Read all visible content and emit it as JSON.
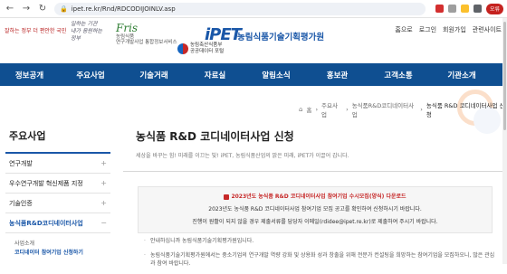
{
  "browser": {
    "url": "ipet.re.kr/Rnd/RDCODIJOINLV.asp",
    "profile_label": "오류",
    "extension_colors": [
      "#d32f2f",
      "#9e9e9e",
      "#fbc02d",
      "#5f6368"
    ]
  },
  "util_links": [
    "홈으로",
    "로그인",
    "회원가입",
    "관련사이트"
  ],
  "header": {
    "banner_left": "잘하는 정부 더 편안한 국민",
    "banner_right_lines": [
      "일하는 기관",
      "내가 응원하는",
      "정부"
    ],
    "fris_logo": "Fris",
    "fris_sub_lines": [
      "농림식품",
      "연구개발사업 통합정보서비스"
    ],
    "public_data_lines": [
      "농림축산식품부",
      "공공데이터 포털"
    ],
    "logo_text": "iPET",
    "org_name": "농림식품기술기획평가원",
    "accent_color": "#1a57a8"
  },
  "gnb": {
    "background": "#0f4f91",
    "items": [
      "정보공개",
      "주요사업",
      "기술거래",
      "자료실",
      "알림소식",
      "홍보관",
      "고객소통",
      "기관소개"
    ]
  },
  "breadcrumb": {
    "home_icon": "home-icon",
    "items": [
      "홈",
      "주요사업",
      "농식품R&D코디네이터사업",
      "농식품 R&D 코디네이터사업 신청"
    ]
  },
  "sidebar": {
    "title": "주요사업",
    "items": [
      {
        "label": "연구개발",
        "expand": "+"
      },
      {
        "label": "우수연구개발 혁신제품 지정",
        "expand": "+"
      },
      {
        "label": "기술인증",
        "expand": "+"
      },
      {
        "label": "농식품R&D코디네이터사업",
        "expand": "−"
      }
    ],
    "sub_items": [
      "사업소개",
      "코디네이터 참여기업 신청하기"
    ]
  },
  "content": {
    "title": "농식품 R&D 코디네이터사업 신청",
    "subtitle": "세상을 바꾸는 힘! 미래를 이끄는 빛! iPET, 농림식품산업의 밝은 미래, iPET가 이끌어 갑니다.",
    "notice": {
      "headline": "2023년도 농식품 R&D 코디네이터사업 참여기업 수시모집(양식) 다운로드",
      "line2": "2023년도 농식품 R&D 코디네이터사업 참여기업 모집 공고를 확인하여 신청하시기 바랍니다.",
      "line3": "진행이 원활이 되지 않을 경우 제출서류를 담당자 이메일(rdidee@ipet.re.kr)로 제출하여 주시기 바랍니다."
    },
    "bullets": [
      "안내하십니까 농림식품기술기획평가원입니다.",
      "농림식품기술기획평가원에서는 중소기업의 연구개발 역량 강화 및 상용화 성과 창출을 위해 전문가 컨설팅을 희망하는 참여기업을 모집하오니, 많은 관심과 참여 바랍니다."
    ]
  }
}
